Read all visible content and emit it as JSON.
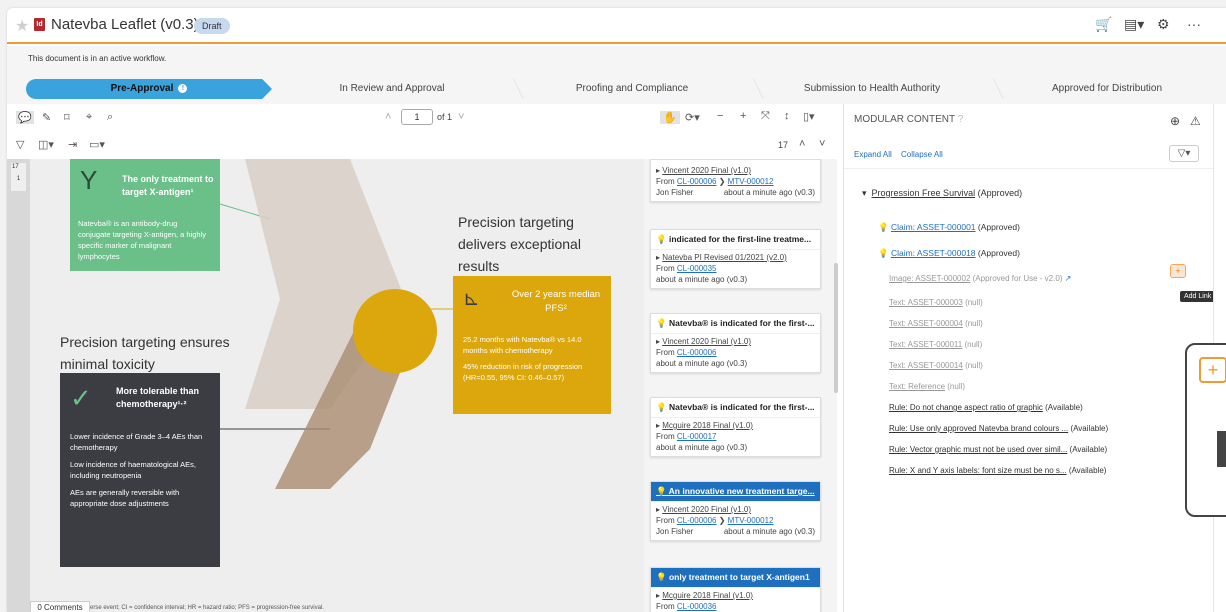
{
  "header": {
    "title": "Natevba Leaflet (v0.3)",
    "badge": "Draft",
    "doc_icon": "Id"
  },
  "workflow": {
    "message": "This document is in an active workflow.",
    "steps": [
      {
        "label": "Pre-Approval"
      },
      {
        "label": "In Review and Approval"
      },
      {
        "label": "Proofing and Compliance"
      },
      {
        "label": "Submission to Health Authority"
      },
      {
        "label": "Approved for Distribution"
      }
    ],
    "active_info": "!"
  },
  "viewer": {
    "page_current": "1",
    "page_total": "of 1",
    "zoom_count": "17"
  },
  "document": {
    "page_badge_top": "17",
    "page_badge_num": "1",
    "green_heading": "The only treatment to target X-antigen¹",
    "green_body": "Natevba® is an antibody-drug conjugate targeting X-antigen, a highly specific marker of malignant lymphocytes",
    "heading_right": "Precision targeting delivers exceptional results",
    "gold_heading": "Over 2 years median PFS²",
    "gold_bullets": [
      "25.2 months with Natevba® vs 14.0 months with chemotherapy",
      "45% reduction in risk of progression (HR=0.55, 95% CI: 0.46–0.57)"
    ],
    "heading_left": "Precision targeting ensures minimal toxicity",
    "dark_heading": "More tolerable than chemotherapy¹·²",
    "dark_bullets": [
      "Lower incidence of Grade 3–4 AEs than chemotherapy",
      "Low incidence of haematological AEs, including neutropenia",
      "AEs are generally reversible with appropriate dose adjustments"
    ],
    "footer_text": "erse event; CI = confidence interval; HR = hazard ratio; PFS = progression-free survival.",
    "comments_tab": "0 Comments"
  },
  "comments": [
    {
      "title": "",
      "source": "Vincent 2020 Final (v1.0)",
      "from": "From",
      "cl": "CL-000006",
      "mtv": "MTV-000012",
      "user": "Jon Fisher",
      "time": "about a minute ago (v0.3)"
    },
    {
      "title": "indicated for the first-line treatme...",
      "source": "Natevba PI Revised 01/2021 (v2.0)",
      "from": "From",
      "cl": "CL-000035",
      "time": "about a minute ago (v0.3)"
    },
    {
      "title": "Natevba® is indicated for the first-...",
      "source": "Vincent 2020 Final (v1.0)",
      "from": "From",
      "cl": "CL-000006",
      "time": "about a minute ago (v0.3)"
    },
    {
      "title": "Natevba® is indicated for the first-...",
      "source": "Mcguire 2018 Final (v1.0)",
      "from": "From",
      "cl": "CL-000017",
      "time": "about a minute ago (v0.3)"
    },
    {
      "title": "An innovative new treatment targe...",
      "source": "Vincent 2020 Final (v1.0)",
      "from": "From",
      "cl": "CL-000006",
      "mtv": "MTV-000012",
      "user": "Jon Fisher",
      "time": "about a minute ago (v0.3)"
    },
    {
      "title": "only treatment to target X-antigen1",
      "source": "Mcguire 2018 Final (v1.0)",
      "from": "From",
      "cl": "CL-000036"
    }
  ],
  "modular": {
    "title": "MODULAR CONTENT",
    "expand_all": "Expand All",
    "collapse_all": "Collapse All",
    "root": {
      "label": "Progression Free Survival",
      "status": "(Approved)"
    },
    "claims": [
      {
        "label": "Claim: ASSET-000001",
        "status": "(Approved)"
      },
      {
        "label": "Claim: ASSET-000018",
        "status": "(Approved)"
      }
    ],
    "assets": [
      {
        "label": "Image: ASSET-000002",
        "status": "(Approved for Use - v2.0)"
      },
      {
        "label": "Text: ASSET-000003",
        "status": "(null)"
      },
      {
        "label": "Text: ASSET-000004",
        "status": "(null)"
      },
      {
        "label": "Text: ASSET-000011",
        "status": "(null)"
      },
      {
        "label": "Text: ASSET-000014",
        "status": "(null)"
      },
      {
        "label": "Text: Reference",
        "status": "(null)"
      }
    ],
    "rules": [
      {
        "label": "Rule: Do not change aspect ratio of graphic",
        "status": "(Available)"
      },
      {
        "label": "Rule: Use only approved Natevba brand colours ...",
        "status": "(Available)"
      },
      {
        "label": "Rule: Vector graphic must not be used over simil...",
        "status": "(Available)"
      },
      {
        "label": "Rule: X and Y axis labels: font size must be no s...",
        "status": "(Available)"
      }
    ],
    "tooltip": "Add Link"
  },
  "colors": {
    "accent": "#3aa3de",
    "brand_orange": "#f09a33",
    "link": "#1f6fbf"
  }
}
